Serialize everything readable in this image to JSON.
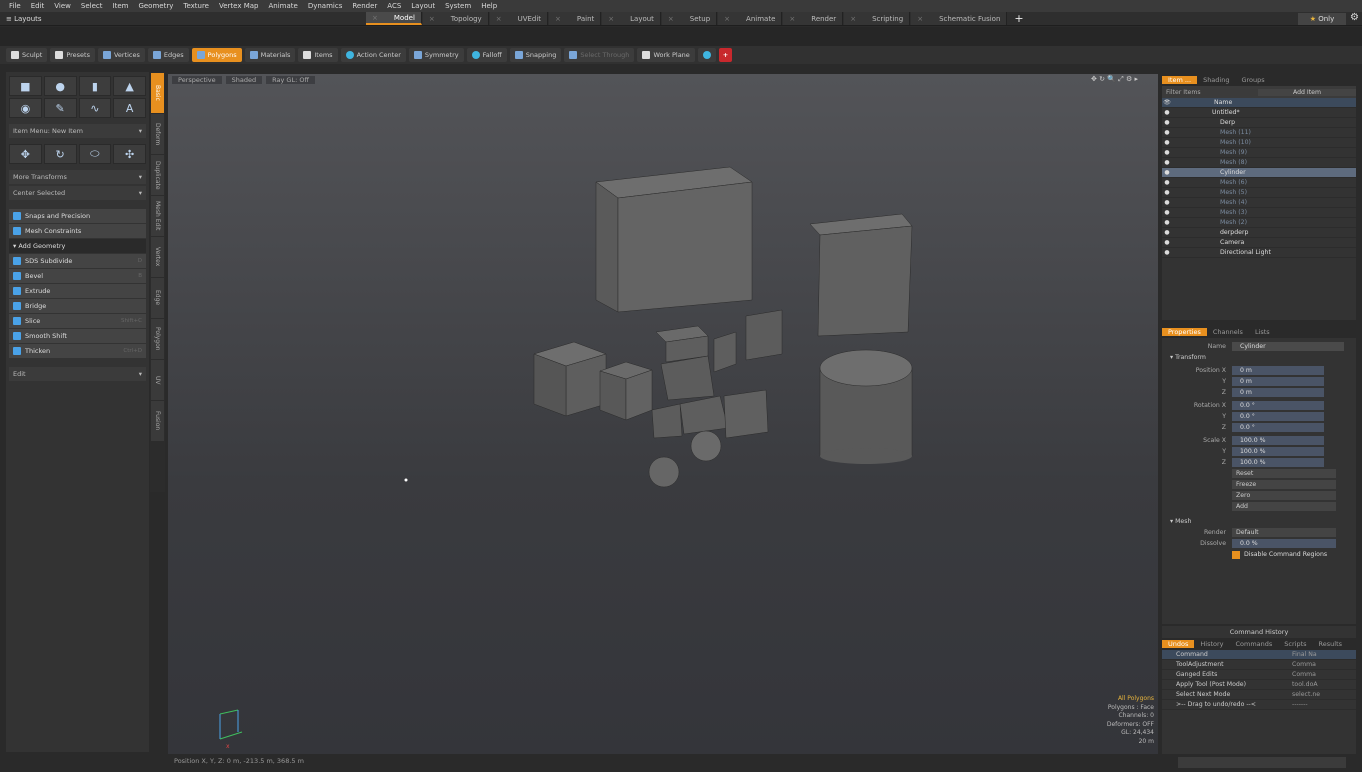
{
  "menu": [
    "File",
    "Edit",
    "View",
    "Select",
    "Item",
    "Geometry",
    "Texture",
    "Vertex Map",
    "Animate",
    "Dynamics",
    "Render",
    "ACS",
    "Layout",
    "System",
    "Help"
  ],
  "layouts_label": "Layouts",
  "tabs": [
    {
      "label": "Model",
      "active": true
    },
    {
      "label": "Topology",
      "active": false
    },
    {
      "label": "UVEdit",
      "active": false
    },
    {
      "label": "Paint",
      "active": false
    },
    {
      "label": "Layout",
      "active": false
    },
    {
      "label": "Setup",
      "active": false
    },
    {
      "label": "Animate",
      "active": false
    },
    {
      "label": "Render",
      "active": false
    },
    {
      "label": "Scripting",
      "active": false
    },
    {
      "label": "Schematic Fusion",
      "active": false
    }
  ],
  "only_label": "Only",
  "toolbar": {
    "sculpt": "Sculpt",
    "presets": "Presets",
    "vertices": "Vertices",
    "edges": "Edges",
    "polygons": "Polygons",
    "materials": "Materials",
    "items": "Items",
    "action_center": "Action Center",
    "symmetry": "Symmetry",
    "falloff": "Falloff",
    "snapping": "Snapping",
    "select_through": "Select Through",
    "work_plane": "Work Plane"
  },
  "left_panel": {
    "item_menu": "Item Menu: New Item",
    "more_transforms": "More Transforms",
    "center_selected": "Center Selected",
    "tools": [
      {
        "label": "Snaps and Precision",
        "shortcut": ""
      },
      {
        "label": "Mesh Constraints",
        "shortcut": ""
      }
    ],
    "add_geometry": "Add Geometry",
    "geo_tools": [
      {
        "label": "SDS Subdivide",
        "shortcut": "D"
      },
      {
        "label": "Bevel",
        "shortcut": "B"
      },
      {
        "label": "Extrude",
        "shortcut": ""
      },
      {
        "label": "Bridge",
        "shortcut": ""
      },
      {
        "label": "Slice",
        "shortcut": "Shift+C"
      },
      {
        "label": "Smooth Shift",
        "shortcut": ""
      },
      {
        "label": "Thicken",
        "shortcut": "Ctrl+D"
      }
    ],
    "edit": "Edit"
  },
  "vtabs": [
    "Basic",
    "Deform",
    "Duplicate",
    "Mesh Edit",
    "Vertex",
    "Edge",
    "Polygon",
    "UV",
    "Fusion"
  ],
  "viewport": {
    "view": "Perspective",
    "shading": "Shaded",
    "raygl": "Ray GL: Off",
    "info": {
      "all_polygons": "All Polygons",
      "polygons": "Polygons : Face",
      "channels": "Channels: 0",
      "deformers": "Deformers: OFF",
      "gl": "GL: 24,434",
      "scale": "20 m"
    }
  },
  "status": "Position X, Y, Z:  0 m, -213.5 m, 368.5 m",
  "items_panel": {
    "tabs": [
      "Item ...",
      "Shading",
      "Groups"
    ],
    "filter": "Filter Items",
    "add_item": "Add Item",
    "name_col": "Name",
    "rows": [
      {
        "name": "Untitled*",
        "dim": false,
        "sel": false
      },
      {
        "name": "Derp",
        "dim": false,
        "sel": false
      },
      {
        "name": "Mesh (11)",
        "dim": true,
        "sel": false
      },
      {
        "name": "Mesh (10)",
        "dim": true,
        "sel": false
      },
      {
        "name": "Mesh (9)",
        "dim": true,
        "sel": false
      },
      {
        "name": "Mesh (8)",
        "dim": true,
        "sel": false
      },
      {
        "name": "Cylinder",
        "dim": false,
        "sel": true
      },
      {
        "name": "Mesh (6)",
        "dim": true,
        "sel": false
      },
      {
        "name": "Mesh (5)",
        "dim": true,
        "sel": false
      },
      {
        "name": "Mesh (4)",
        "dim": true,
        "sel": false
      },
      {
        "name": "Mesh (3)",
        "dim": true,
        "sel": false
      },
      {
        "name": "Mesh (2)",
        "dim": true,
        "sel": false
      },
      {
        "name": "derpderp",
        "dim": false,
        "sel": false
      },
      {
        "name": "Camera",
        "dim": false,
        "sel": false
      },
      {
        "name": "Directional Light",
        "dim": false,
        "sel": false
      }
    ]
  },
  "props_panel": {
    "tabs": [
      "Properties",
      "Channels",
      "Lists"
    ],
    "name_label": "Name",
    "name_value": "Cylinder",
    "transform": "Transform",
    "rows": [
      {
        "label": "Position X",
        "value": "0 m"
      },
      {
        "label": "Y",
        "value": "0 m"
      },
      {
        "label": "Z",
        "value": "0 m"
      },
      {
        "label": "Rotation X",
        "value": "0.0 °"
      },
      {
        "label": "Y",
        "value": "0.0 °"
      },
      {
        "label": "Z",
        "value": "0.0 °"
      },
      {
        "label": "Scale X",
        "value": "100.0 %"
      },
      {
        "label": "Y",
        "value": "100.0 %"
      },
      {
        "label": "Z",
        "value": "100.0 %"
      }
    ],
    "buttons": [
      "Reset",
      "Freeze",
      "Zero",
      "Add"
    ],
    "mesh": "Mesh",
    "render_label": "Render",
    "render_value": "Default",
    "dissolve_label": "Dissolve",
    "dissolve_value": "0.0 %",
    "disable_regions": "Disable Command Regions"
  },
  "cmd_panel": {
    "title": "Command History",
    "tabs": [
      "Undos",
      "History",
      "Commands",
      "Scripts",
      "Results"
    ],
    "col1": "Command",
    "col2": "Final Na",
    "rows": [
      {
        "a": "ToolAdjustment",
        "b": "Comma"
      },
      {
        "a": "Ganged Edits",
        "b": "Comma"
      },
      {
        "a": "Apply Tool (Post Mode)",
        "b": "tool.doA"
      },
      {
        "a": "Select Next Mode",
        "b": "select.ne"
      },
      {
        "a": ">-- Drag to undo/redo --<",
        "b": "-------"
      }
    ]
  }
}
